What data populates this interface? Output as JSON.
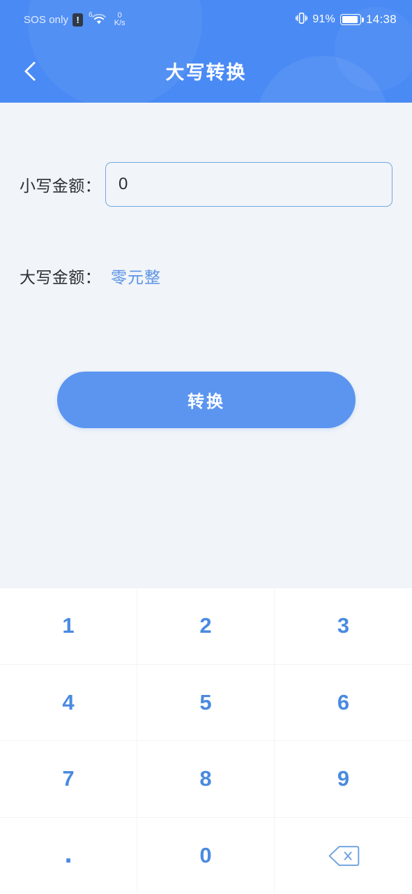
{
  "statusbar": {
    "carrier": "SOS only",
    "alert_badge": "!",
    "wifi_gen": "6",
    "wifi_icon": "wifi-icon",
    "net_speed_value": "0",
    "net_speed_unit": "K/s",
    "vibrate_icon": "vibrate-icon",
    "battery_percent": "91%",
    "battery_level": 91,
    "time": "14:38"
  },
  "header": {
    "back_icon": "chevron-left-icon",
    "title": "大写转换",
    "background_color": "#4a8af4"
  },
  "form": {
    "lowercase_label": "小写金额：",
    "lowercase_value": "0",
    "lowercase_placeholder": "0",
    "uppercase_label": "大写金额：",
    "uppercase_value": "零元整",
    "uppercase_color": "#5b93e8",
    "convert_button": "转换",
    "convert_button_color": "#5b95f0"
  },
  "keypad": {
    "key_color": "#4a8ae0",
    "keys": [
      {
        "label": "1",
        "name": "key-1"
      },
      {
        "label": "2",
        "name": "key-2"
      },
      {
        "label": "3",
        "name": "key-3"
      },
      {
        "label": "4",
        "name": "key-4"
      },
      {
        "label": "5",
        "name": "key-5"
      },
      {
        "label": "6",
        "name": "key-6"
      },
      {
        "label": "7",
        "name": "key-7"
      },
      {
        "label": "8",
        "name": "key-8"
      },
      {
        "label": "9",
        "name": "key-9"
      },
      {
        "label": ".",
        "name": "key-decimal"
      },
      {
        "label": "0",
        "name": "key-0"
      },
      {
        "label": "",
        "name": "key-backspace"
      }
    ]
  }
}
